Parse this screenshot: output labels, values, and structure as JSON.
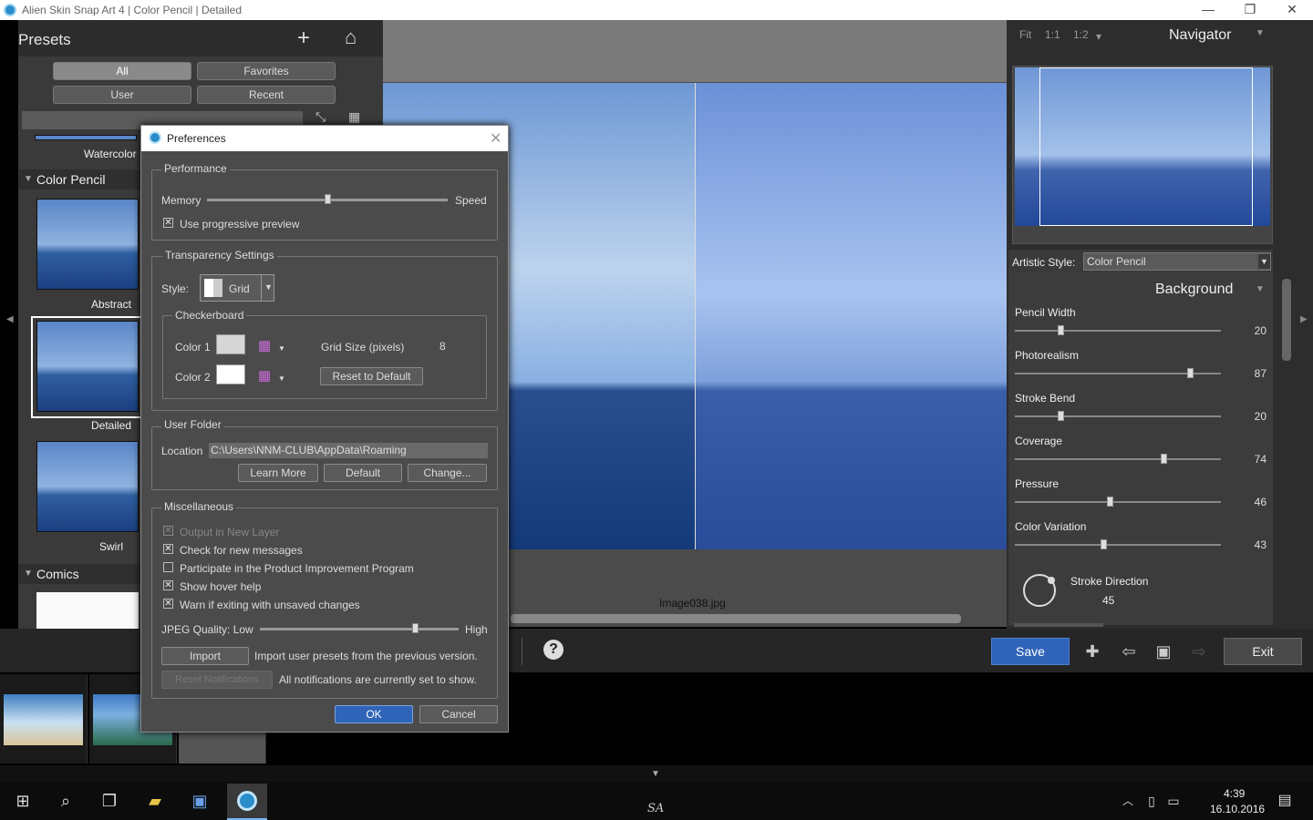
{
  "titlebar": {
    "title": "Alien Skin Snap Art 4 | Color Pencil | Detailed",
    "minimize": "—",
    "restore": "❐",
    "close": "✕"
  },
  "presets": {
    "title": "Presets",
    "add": "+",
    "home": "⌂",
    "filters": {
      "all": "All",
      "favorites": "Favorites",
      "user": "User",
      "recent": "Recent"
    },
    "partial_label": "Watercolor",
    "sections": {
      "color_pencil": "Color Pencil",
      "comics": "Comics"
    },
    "items": [
      {
        "label": "Abstract"
      },
      {
        "label": "Detailed"
      },
      {
        "label": "Swirl"
      }
    ]
  },
  "canvas": {
    "filename": "Image038.jpg"
  },
  "toolbar": {
    "save": "Save",
    "exit": "Exit",
    "help": "?"
  },
  "navigator": {
    "zoom_fit": "Fit",
    "zoom_1_1": "1:1",
    "zoom_1_2": "1:2",
    "title": "Navigator"
  },
  "style": {
    "label": "Artistic Style:",
    "value": "Color Pencil"
  },
  "layer": {
    "title": "Background"
  },
  "sliders": [
    {
      "label": "Pencil Width",
      "value": "20",
      "pos": 0.22
    },
    {
      "label": "Photorealism",
      "value": "87",
      "pos": 0.85
    },
    {
      "label": "Stroke Bend",
      "value": "20",
      "pos": 0.22
    },
    {
      "label": "Coverage",
      "value": "74",
      "pos": 0.72
    },
    {
      "label": "Pressure",
      "value": "46",
      "pos": 0.46
    },
    {
      "label": "Color Variation",
      "value": "43",
      "pos": 0.43
    }
  ],
  "stroke_direction": {
    "label": "Stroke Direction",
    "value": "45"
  },
  "preferences": {
    "title": "Preferences",
    "performance": {
      "title": "Performance",
      "memory": "Memory",
      "speed": "Speed",
      "memory_pos": 0.5,
      "progressive": "Use progressive preview",
      "progressive_checked": true
    },
    "transparency": {
      "title": "Transparency Settings",
      "style_label": "Style:",
      "style_value": "Grid",
      "checkerboard": {
        "title": "Checkerboard",
        "color1": "Color 1",
        "color2": "Color 2",
        "grid_size_label": "Grid Size (pixels)",
        "grid_size": "8",
        "reset": "Reset to Default"
      }
    },
    "user_folder": {
      "title": "User Folder",
      "location_label": "Location",
      "location": "C:\\Users\\NNM-CLUB\\AppData\\Roaming",
      "learn_more": "Learn More",
      "default": "Default",
      "change": "Change..."
    },
    "misc": {
      "title": "Miscellaneous",
      "items": [
        {
          "label": "Output in New Layer",
          "checked": true,
          "disabled": true
        },
        {
          "label": "Check for new messages",
          "checked": true,
          "disabled": false
        },
        {
          "label": "Participate in the Product Improvement Program",
          "checked": false,
          "disabled": false
        },
        {
          "label": "Show hover help",
          "checked": true,
          "disabled": false
        },
        {
          "label": "Warn if exiting with unsaved changes",
          "checked": true,
          "disabled": false
        }
      ],
      "jpeg_label": "JPEG Quality: Low",
      "jpeg_high": "High",
      "jpeg_pos": 0.78,
      "import": "Import",
      "import_desc": "Import user presets from the previous version.",
      "reset_notifications": "Reset Notifications",
      "notifications_desc": "All notifications are currently set to show."
    },
    "ok": "OK",
    "cancel": "Cancel"
  },
  "taskbar": {
    "time": "4:39",
    "date": "16.10.2016",
    "center": "SA"
  }
}
